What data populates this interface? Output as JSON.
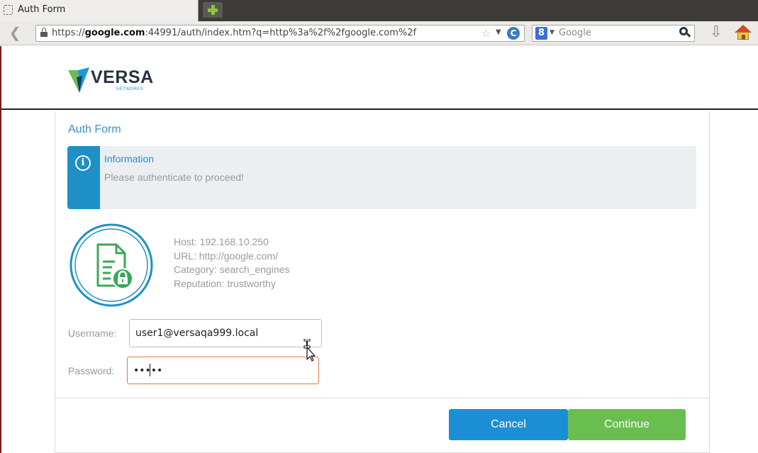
{
  "browser": {
    "tab_title": "Auth Form",
    "url_scheme": "https://",
    "url_domain": "google.com",
    "url_rest": ":44991/auth/index.htm?q=http%3a%2f%2fgoogle.com%2f",
    "search_engine": "Google",
    "search_engine_badge": "8"
  },
  "logo": {
    "name": "VERSA",
    "sub": "NETWORKS"
  },
  "form": {
    "title": "Auth Form",
    "info_title": "Information",
    "info_message": "Please authenticate to proceed!",
    "info_icon": "i",
    "host": "Host: 192.168.10.250",
    "url": "URL: http://google.com/",
    "category": "Category: search_engines",
    "reputation": "Reputation: trustworthy",
    "username_label": "Username:",
    "username_value": "user1@versaqa999.local",
    "password_label": "Password:",
    "password_value": "•••••",
    "cancel_label": "Cancel",
    "continue_label": "Continue"
  },
  "colors": {
    "accent_blue": "#1b8fd6",
    "continue_green": "#6abd4f",
    "info_strip": "#1e90c7",
    "badge_green": "#3aa859",
    "password_focus_border": "#e07a3f"
  },
  "icons": {
    "tab": "page-placeholder-icon",
    "new_tab": "plus-icon",
    "back": "back-arrow-icon",
    "lock": "lock-icon",
    "bookmark": "star-icon",
    "reload": "reload-icon",
    "search_engine": "google-icon",
    "search_go": "search-icon",
    "downloads": "download-icon",
    "home": "home-icon",
    "info": "info-icon",
    "document_lock": "document-lock-icon",
    "cursor": "mouse-cursor-icon"
  }
}
